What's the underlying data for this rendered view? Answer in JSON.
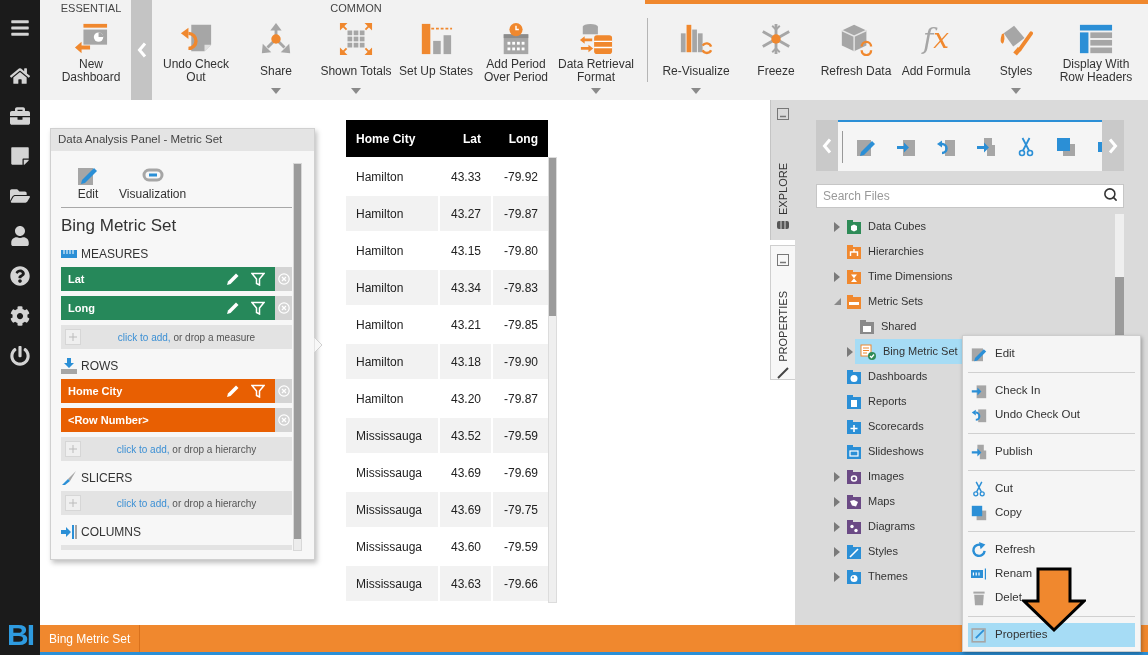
{
  "sidebar": {
    "logo": "BI"
  },
  "toolbar": {
    "groups": [
      {
        "label": "ESSENTIAL",
        "buttons": [
          {
            "kind": "dashboard",
            "label": "New Dashboard",
            "dropdown": false
          }
        ]
      },
      {
        "label": "COMMON",
        "buttons": [
          {
            "kind": "undo",
            "label": "Undo Check Out",
            "dropdown": false
          },
          {
            "kind": "share",
            "label": "Share",
            "dropdown": true
          },
          {
            "kind": "totals",
            "label": "Shown Totals",
            "dropdown": true
          },
          {
            "kind": "states",
            "label": "Set Up States",
            "dropdown": false
          },
          {
            "kind": "period",
            "label": "Add Period Over Period",
            "dropdown": false
          },
          {
            "kind": "retrieval",
            "label": "Data Retrieval Format",
            "dropdown": true
          }
        ]
      },
      {
        "buttons": [
          {
            "kind": "revisualize",
            "label": "Re-Visualize",
            "dropdown": true
          },
          {
            "kind": "freeze",
            "label": "Freeze",
            "dropdown": false
          },
          {
            "kind": "refresh",
            "label": "Refresh Data",
            "dropdown": false
          },
          {
            "kind": "formula",
            "glyph": "fx",
            "label": "Add Formula",
            "dropdown": false
          },
          {
            "kind": "styles",
            "label": "Styles",
            "dropdown": true
          },
          {
            "kind": "rowheaders",
            "label": "Display With Row Headers",
            "dropdown": false
          }
        ]
      }
    ]
  },
  "analysis_panel": {
    "title": "Data Analysis Panel - Metric Set",
    "actions": [
      {
        "kind": "edit",
        "label": "Edit"
      },
      {
        "kind": "visualization",
        "label": "Visualization"
      }
    ],
    "heading": "Bing Metric Set",
    "sections": [
      {
        "kind": "measures",
        "label": "MEASURES",
        "items": [
          {
            "kind": "measure",
            "label": "Lat",
            "edit": true,
            "filter": true
          },
          {
            "kind": "measure",
            "label": "Long",
            "edit": true,
            "filter": true
          }
        ],
        "add_prompt": {
          "link": "click to add,",
          "text": "or drop a measure"
        }
      },
      {
        "kind": "rows",
        "label": "ROWS",
        "items": [
          {
            "kind": "hierarchy",
            "label": "Home City",
            "edit": true,
            "filter": true
          },
          {
            "kind": "hierarchy",
            "label": "<Row Number>",
            "edit": false,
            "filter": false
          }
        ],
        "add_prompt": {
          "link": "click to add,",
          "text": "or drop a hierarchy"
        }
      },
      {
        "kind": "slicers",
        "label": "SLICERS",
        "add_prompt": {
          "link": "click to add,",
          "text": "or drop a hierarchy"
        }
      },
      {
        "kind": "columns",
        "label": "COLUMNS"
      }
    ]
  },
  "table": {
    "columns": [
      "Home City",
      "Lat",
      "Long"
    ],
    "rows": [
      [
        "Hamilton",
        "43.33",
        "-79.92"
      ],
      [
        "Hamilton",
        "43.27",
        "-79.87"
      ],
      [
        "Hamilton",
        "43.15",
        "-79.80"
      ],
      [
        "Hamilton",
        "43.34",
        "-79.83"
      ],
      [
        "Hamilton",
        "43.21",
        "-79.85"
      ],
      [
        "Hamilton",
        "43.18",
        "-79.90"
      ],
      [
        "Hamilton",
        "43.20",
        "-79.87"
      ],
      [
        "Mississauga",
        "43.52",
        "-79.59"
      ],
      [
        "Mississauga",
        "43.69",
        "-79.69"
      ],
      [
        "Mississauga",
        "43.69",
        "-79.75"
      ],
      [
        "Mississauga",
        "43.60",
        "-79.59"
      ],
      [
        "Mississauga",
        "43.63",
        "-79.66"
      ]
    ]
  },
  "explorer": {
    "tabs": [
      {
        "label": "EXPLORE",
        "selected": true
      },
      {
        "label": "PROPERTIES",
        "selected": false
      }
    ],
    "search": {
      "placeholder": "Search Files"
    },
    "tree": [
      {
        "kind": "cubes",
        "label": "Data Cubes",
        "expanded": false,
        "selected": false
      },
      {
        "kind": "hierarchies",
        "label": "Hierarchies",
        "selected": false
      },
      {
        "kind": "time",
        "label": "Time Dimensions",
        "expanded": false,
        "selected": false
      },
      {
        "kind": "metrics",
        "label": "Metric Sets",
        "expanded": true,
        "selected": false,
        "children": [
          {
            "kind": "shared",
            "label": "Shared",
            "selected": false
          },
          {
            "kind": "metricset",
            "label": "Bing Metric Set",
            "expanded": false,
            "selected": true
          }
        ]
      },
      {
        "kind": "dashboards",
        "label": "Dashboards",
        "selected": false
      },
      {
        "kind": "reports",
        "label": "Reports",
        "selected": false
      },
      {
        "kind": "scorecards",
        "label": "Scorecards",
        "selected": false
      },
      {
        "kind": "slideshows",
        "label": "Slideshows",
        "selected": false
      },
      {
        "kind": "images",
        "label": "Images",
        "expanded": false,
        "selected": false
      },
      {
        "kind": "maps",
        "label": "Maps",
        "expanded": false,
        "selected": false
      },
      {
        "kind": "diagrams",
        "label": "Diagrams",
        "expanded": false,
        "selected": false
      },
      {
        "kind": "styles",
        "label": "Styles",
        "expanded": false,
        "selected": false
      },
      {
        "kind": "themes",
        "label": "Themes",
        "expanded": false,
        "selected": false
      }
    ]
  },
  "context_menu": {
    "sections": [
      {
        "items": [
          {
            "kind": "edit",
            "label": "Edit",
            "selected": false
          }
        ]
      },
      {
        "items": [
          {
            "kind": "checkin",
            "label": "Check In",
            "selected": false
          },
          {
            "kind": "undo",
            "label": "Undo Check Out",
            "selected": false
          }
        ]
      },
      {
        "items": [
          {
            "kind": "publish",
            "label": "Publish",
            "selected": false
          }
        ]
      },
      {
        "items": [
          {
            "kind": "cut",
            "label": "Cut",
            "selected": false
          },
          {
            "kind": "copy",
            "label": "Copy",
            "selected": false
          }
        ]
      },
      {
        "items": [
          {
            "kind": "refresh",
            "label": "Refresh",
            "selected": false
          },
          {
            "kind": "rename",
            "label": "Renam",
            "selected": false
          },
          {
            "kind": "delete",
            "label": "Delet",
            "selected": false
          }
        ]
      },
      {
        "items": [
          {
            "kind": "properties",
            "label": "Properties",
            "selected": true
          }
        ]
      }
    ]
  },
  "status_bar": {
    "tabs": [
      {
        "label": "Bing Metric Set"
      }
    ]
  }
}
